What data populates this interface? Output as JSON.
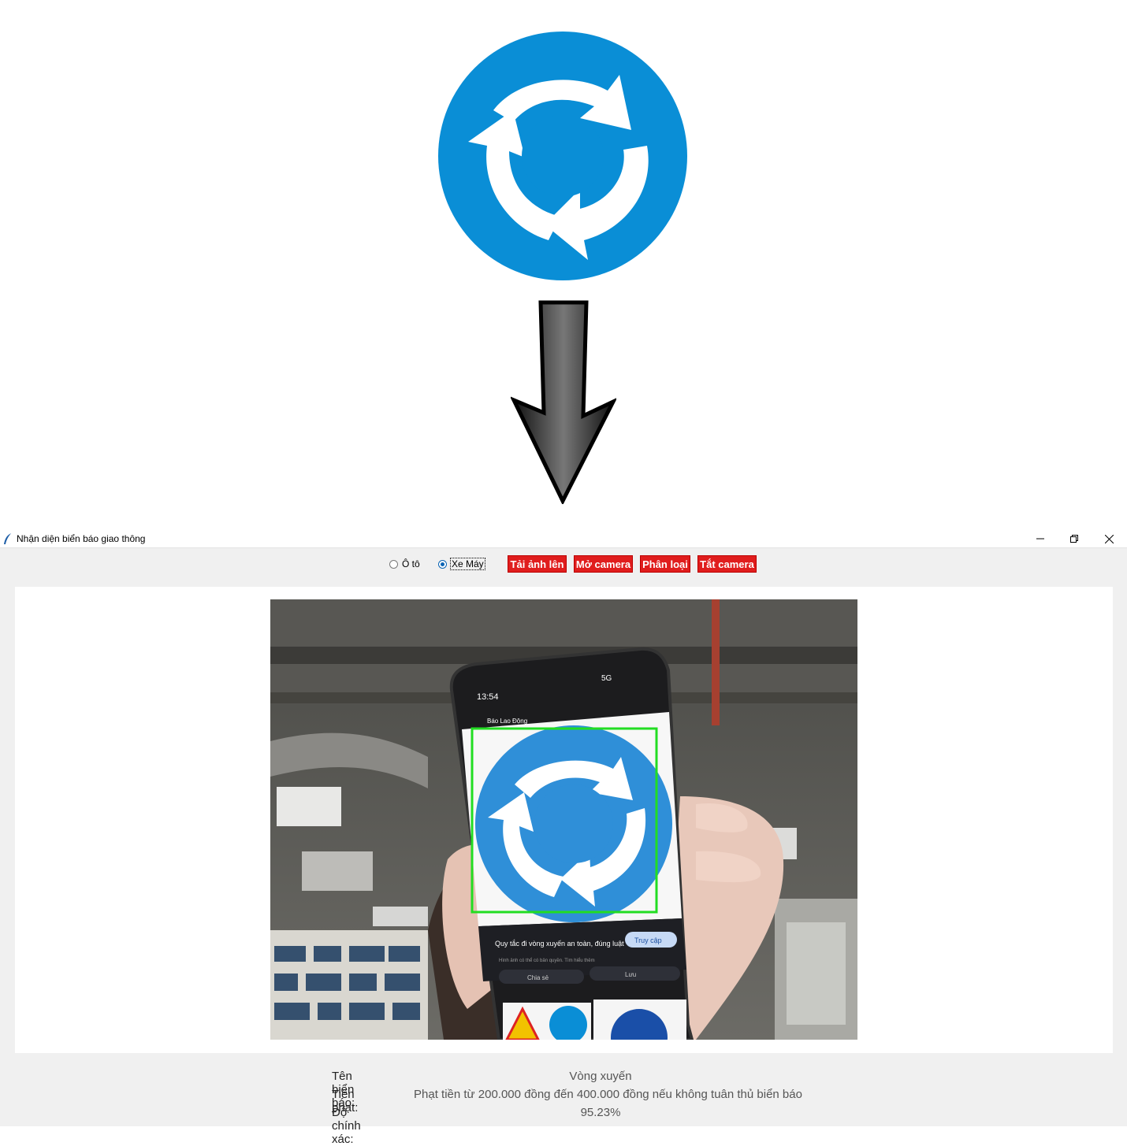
{
  "window": {
    "title": "Nhận diện biển báo giao thông"
  },
  "toolbar": {
    "vehicle_options": [
      {
        "label": "Ô tô",
        "selected": false
      },
      {
        "label": "Xe Máy",
        "selected": true
      }
    ],
    "buttons": [
      {
        "label": "Tải ảnh lên"
      },
      {
        "label": "Mở camera"
      },
      {
        "label": "Phân loại"
      },
      {
        "label": "Tắt camera"
      }
    ],
    "button_color": "#e01d1d"
  },
  "camera_view": {
    "phone_status_time": "13:54",
    "phone_status_network": "5G",
    "phone_source": "Báo Lao Động",
    "phone_caption": "Quy tắc đi vòng xuyến an toàn, đúng luật",
    "phone_subcaption": "Hình ảnh có thể có bản quyền. Tìm hiểu thêm",
    "phone_visit_button": "Truy cập",
    "phone_share": "Chia sẻ",
    "phone_save": "Lưu",
    "detection_box_color": "#22dd22"
  },
  "results": {
    "sign_name_label": "Tên biển báo:",
    "sign_name_value": "Vòng xuyến",
    "fine_label": "Tiền phạt:",
    "fine_value": "Phạt tiền từ 200.000 đồng đến 400.000 đồng nếu không tuân thủ biển báo",
    "accuracy_label": "Độ chính xác:",
    "accuracy_value": "95.23%"
  },
  "colors": {
    "sign_blue": "#0a8ed6"
  }
}
